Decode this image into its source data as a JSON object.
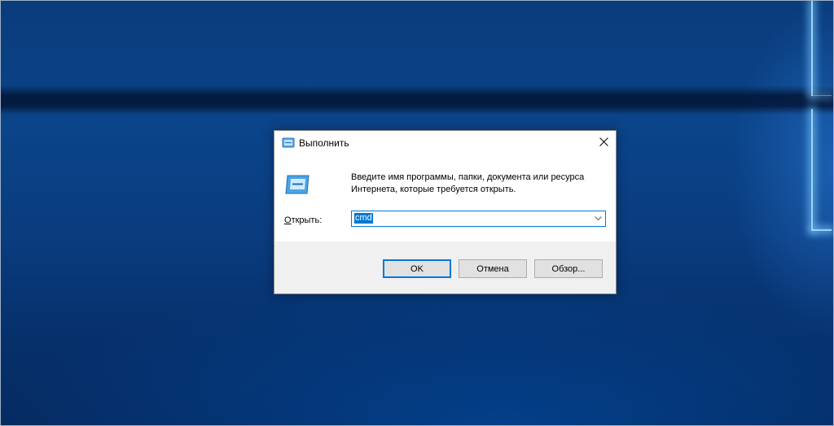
{
  "dialog": {
    "title": "Выполнить",
    "description": "Введите имя программы, папки, документа или ресурса Интернета, которые требуется открыть.",
    "open_label_accel": "О",
    "open_label_rest": "ткрыть:",
    "input_value": "cmd",
    "ok_label": "OK",
    "cancel_label": "Отмена",
    "browse_label": "Обзор..."
  },
  "colors": {
    "accent": "#0078d7",
    "desktop_bg": "#0b4489"
  },
  "icons": {
    "title": "run-icon",
    "close": "close-icon",
    "dropdown": "chevron-down-icon"
  }
}
